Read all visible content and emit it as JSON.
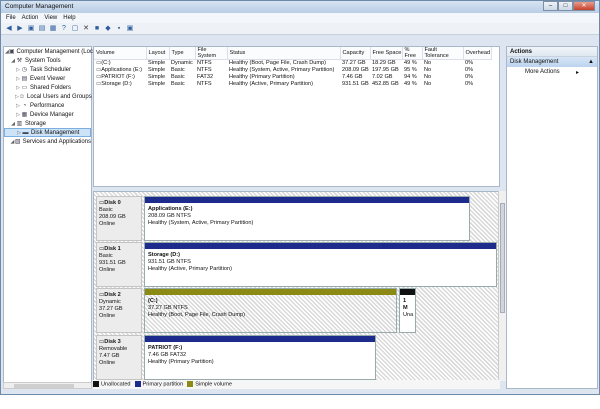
{
  "window": {
    "title": "Computer Management"
  },
  "menubar": [
    "File",
    "Action",
    "View",
    "Help"
  ],
  "toolbar_icons": [
    "back-arrow-icon",
    "forward-arrow-icon",
    "up-folder-icon",
    "console-tree-icon",
    "properties-icon",
    "help-icon",
    "refresh-icon",
    "delete-icon",
    "export-icon",
    "wizard-icon",
    "new-icon",
    "settings-icon"
  ],
  "tree": [
    {
      "label": "Computer Management (Local",
      "level": 0,
      "icon": "computer-icon"
    },
    {
      "label": "System Tools",
      "level": 1,
      "icon": "tools-icon"
    },
    {
      "label": "Task Scheduler",
      "level": 2,
      "icon": "clock-icon"
    },
    {
      "label": "Event Viewer",
      "level": 2,
      "icon": "event-viewer-icon"
    },
    {
      "label": "Shared Folders",
      "level": 2,
      "icon": "folder-icon"
    },
    {
      "label": "Local Users and Groups",
      "level": 2,
      "icon": "users-icon"
    },
    {
      "label": "Performance",
      "level": 2,
      "icon": "performance-icon"
    },
    {
      "label": "Device Manager",
      "level": 2,
      "icon": "device-icon"
    },
    {
      "label": "Storage",
      "level": 1,
      "icon": "storage-icon"
    },
    {
      "label": "Disk Management",
      "level": 2,
      "icon": "disk-icon",
      "selected": true
    },
    {
      "label": "Services and Applications",
      "level": 1,
      "icon": "services-icon"
    }
  ],
  "volumes": {
    "columns": [
      "Volume",
      "Layout",
      "Type",
      "File System",
      "Status",
      "Capacity",
      "Free Space",
      "% Free",
      "Fault Tolerance",
      "Overhead"
    ],
    "rows": [
      [
        "(C:)",
        "Simple",
        "Dynamic",
        "NTFS",
        "Healthy (Boot, Page File, Crash Dump)",
        "37.27 GB",
        "18.29 GB",
        "49 %",
        "No",
        "0%"
      ],
      [
        "Applications (E:)",
        "Simple",
        "Basic",
        "NTFS",
        "Healthy (System, Active, Primary Partition)",
        "208.09 GB",
        "197.95 GB",
        "95 %",
        "No",
        "0%"
      ],
      [
        "PATRIOT (F:)",
        "Simple",
        "Basic",
        "FAT32",
        "Healthy (Primary Partition)",
        "7.46 GB",
        "7.02 GB",
        "94 %",
        "No",
        "0%"
      ],
      [
        "Storage (D:)",
        "Simple",
        "Basic",
        "NTFS",
        "Healthy (Active, Primary Partition)",
        "931.51 GB",
        "452.85 GB",
        "49 %",
        "No",
        "0%"
      ]
    ]
  },
  "disks": [
    {
      "name": "Disk 0",
      "kind": "Basic",
      "size": "208.09 GB",
      "state": "Online",
      "parts": [
        {
          "name": "Applications  (E:)",
          "detail": "208.09 GB NTFS",
          "status": "Healthy (System, Active, Primary Partition)",
          "color": "#1d2b8c",
          "hatch": false
        }
      ]
    },
    {
      "name": "Disk 1",
      "kind": "Basic",
      "size": "931.51 GB",
      "state": "Online",
      "parts": [
        {
          "name": "Storage  (D:)",
          "detail": "931.51 GB NTFS",
          "status": "Healthy (Active, Primary Partition)",
          "color": "#1d2b8c",
          "hatch": false
        }
      ]
    },
    {
      "name": "Disk 2",
      "kind": "Dynamic",
      "size": "37.27 GB",
      "state": "Online",
      "parts": [
        {
          "name": "(C:)",
          "detail": "37.27 GB NTFS",
          "status": "Healthy (Boot, Page File, Crash Dump)",
          "color": "#8a8a14",
          "hatch": true
        },
        {
          "name": "1 M",
          "detail": "Una",
          "status": "",
          "color": "#111111",
          "hatch": false
        }
      ]
    },
    {
      "name": "Disk 3",
      "kind": "Removable",
      "size": "7.47 GB",
      "state": "Online",
      "parts": [
        {
          "name": "PATRIOT  (F:)",
          "detail": "7.46 GB FAT32",
          "status": "Healthy (Primary Partition)",
          "color": "#1d2b8c",
          "hatch": false
        }
      ]
    }
  ],
  "legend": [
    {
      "label": "Unallocated",
      "color": "#111111"
    },
    {
      "label": "Primary partition",
      "color": "#1d2b8c"
    },
    {
      "label": "Simple volume",
      "color": "#8a8a14"
    }
  ],
  "actions": {
    "header": "Actions",
    "section": "Disk Management",
    "item": "More Actions"
  }
}
